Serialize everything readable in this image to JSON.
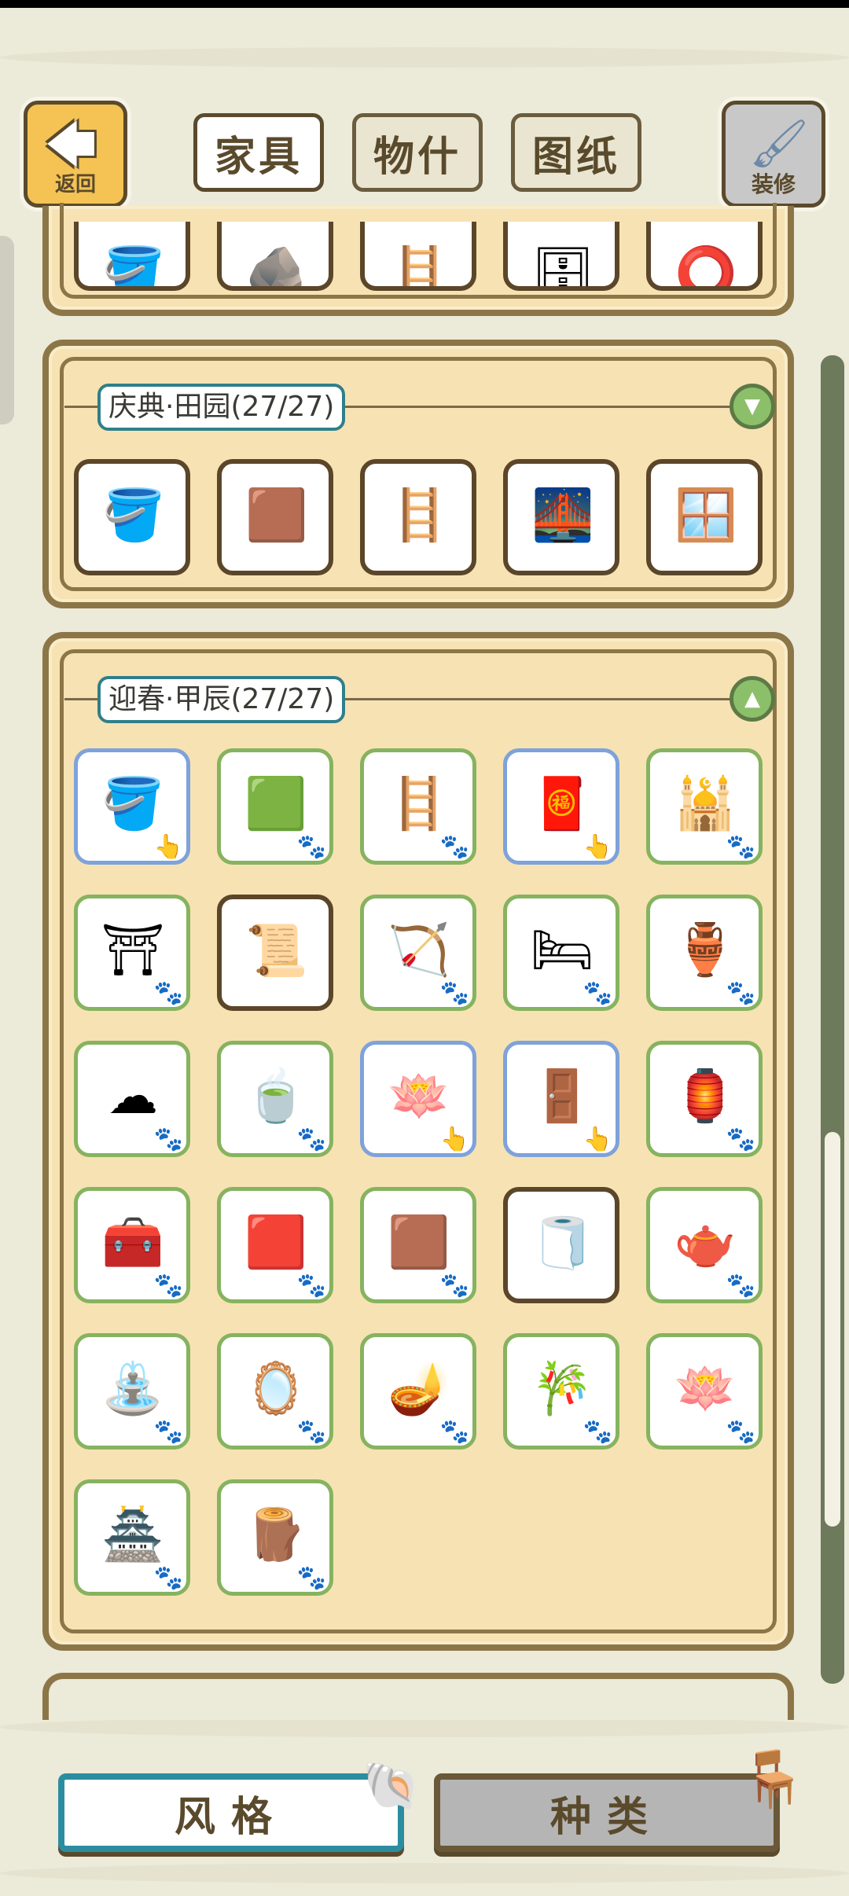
{
  "header": {
    "back_label": "返回",
    "tabs": [
      {
        "label": "家具",
        "active": true
      },
      {
        "label": "物什",
        "active": false
      },
      {
        "label": "图纸",
        "active": false
      }
    ],
    "decorate_label": "装修"
  },
  "sections": [
    {
      "name": "partial-top",
      "title": "",
      "items": [
        {
          "icon": "wall-bucket-icon",
          "glyph": "🪣"
        },
        {
          "icon": "floor-pond-icon",
          "glyph": "🪨"
        },
        {
          "icon": "ladder-icon",
          "glyph": "🪜"
        },
        {
          "icon": "cabinet-icon",
          "glyph": "🗄"
        },
        {
          "icon": "round-window-icon",
          "glyph": "⭕"
        }
      ]
    },
    {
      "name": "qingdian-tianyuan",
      "title": "庆典·田园(27/27)",
      "collapsed": true,
      "toggle_glyph": "▼",
      "items": [
        {
          "icon": "wall-bucket-icon",
          "glyph": "🪣"
        },
        {
          "icon": "floor-mat-icon",
          "glyph": "🟫"
        },
        {
          "icon": "stairs-icon",
          "glyph": "🪜"
        },
        {
          "icon": "arched-bench-icon",
          "glyph": "🌉"
        },
        {
          "icon": "green-window-icon",
          "glyph": "🪟"
        }
      ]
    },
    {
      "name": "yingchun-jiachen",
      "title": "迎春·甲辰(27/27)",
      "collapsed": false,
      "toggle_glyph": "▲",
      "items": [
        {
          "icon": "wall-bucket-icon",
          "glyph": "🪣",
          "state": "blue",
          "badge": "👆"
        },
        {
          "icon": "floor-tile-icon",
          "glyph": "🟩",
          "state": "green",
          "badge": "🐾"
        },
        {
          "icon": "red-ladder-icon",
          "glyph": "🪜",
          "state": "green",
          "badge": "🐾"
        },
        {
          "icon": "red-table-icon",
          "glyph": "🧧",
          "state": "blue",
          "badge": "👆"
        },
        {
          "icon": "ornate-window-icon",
          "glyph": "🕌",
          "state": "green",
          "badge": "🐾"
        },
        {
          "icon": "curtain-frame-icon",
          "glyph": "⛩",
          "state": "green",
          "badge": "🐾"
        },
        {
          "icon": "scroll-bundle-icon",
          "glyph": "📜",
          "state": "brown",
          "badge": ""
        },
        {
          "icon": "scroll-bow-icon",
          "glyph": "🏹",
          "state": "green",
          "badge": "🐾"
        },
        {
          "icon": "bed-icon",
          "glyph": "🛏",
          "state": "green",
          "badge": "🐾"
        },
        {
          "icon": "vase-icon",
          "glyph": "🏺",
          "state": "green",
          "badge": "🐾"
        },
        {
          "icon": "cloud-decor-icon",
          "glyph": "☁",
          "state": "green",
          "badge": "🐾"
        },
        {
          "icon": "low-table-icon",
          "glyph": "🍵",
          "state": "green",
          "badge": "🐾"
        },
        {
          "icon": "cushion-icon",
          "glyph": "🪷",
          "state": "blue",
          "badge": "👆"
        },
        {
          "icon": "wardrobe-icon",
          "glyph": "🚪",
          "state": "blue",
          "badge": "👆"
        },
        {
          "icon": "lantern-icon",
          "glyph": "🏮",
          "state": "green",
          "badge": "🐾"
        },
        {
          "icon": "chest-icon",
          "glyph": "🧰",
          "state": "green",
          "badge": "🐾"
        },
        {
          "icon": "square-table-icon",
          "glyph": "🟥",
          "state": "green",
          "badge": "🐾"
        },
        {
          "icon": "small-table-icon",
          "glyph": "🟫",
          "state": "green",
          "badge": "🐾"
        },
        {
          "icon": "rolled-rug-icon",
          "glyph": "🧻",
          "state": "brown",
          "badge": ""
        },
        {
          "icon": "tea-set-icon",
          "glyph": "🫖",
          "state": "green",
          "badge": "🐾"
        },
        {
          "icon": "rock-fountain-icon",
          "glyph": "⛲",
          "state": "green",
          "badge": "🐾"
        },
        {
          "icon": "mirror-icon",
          "glyph": "🪞",
          "state": "green",
          "badge": "🐾"
        },
        {
          "icon": "coat-stand-icon",
          "glyph": "🪔",
          "state": "green",
          "badge": "🐾"
        },
        {
          "icon": "folding-screen-icon",
          "glyph": "🎋",
          "state": "green",
          "badge": "🐾"
        },
        {
          "icon": "lotus-lamp-icon",
          "glyph": "🪷",
          "state": "green",
          "badge": "🐾"
        },
        {
          "icon": "shrine-cabinet-icon",
          "glyph": "🏯",
          "state": "green",
          "badge": "🐾"
        },
        {
          "icon": "firewood-icon",
          "glyph": "🪵",
          "state": "green",
          "badge": "🐾"
        }
      ]
    }
  ],
  "bottom": {
    "style_label": "风格",
    "type_label": "种类",
    "style_icon": "🐚",
    "type_icon": "🪑"
  },
  "colors": {
    "background": "#ecead9",
    "panel": "#f7e2b4",
    "panel_border": "#8c7648",
    "accent_teal": "#2f7f8a",
    "owned_green": "#86b35f",
    "placed_blue": "#7ea2db"
  }
}
